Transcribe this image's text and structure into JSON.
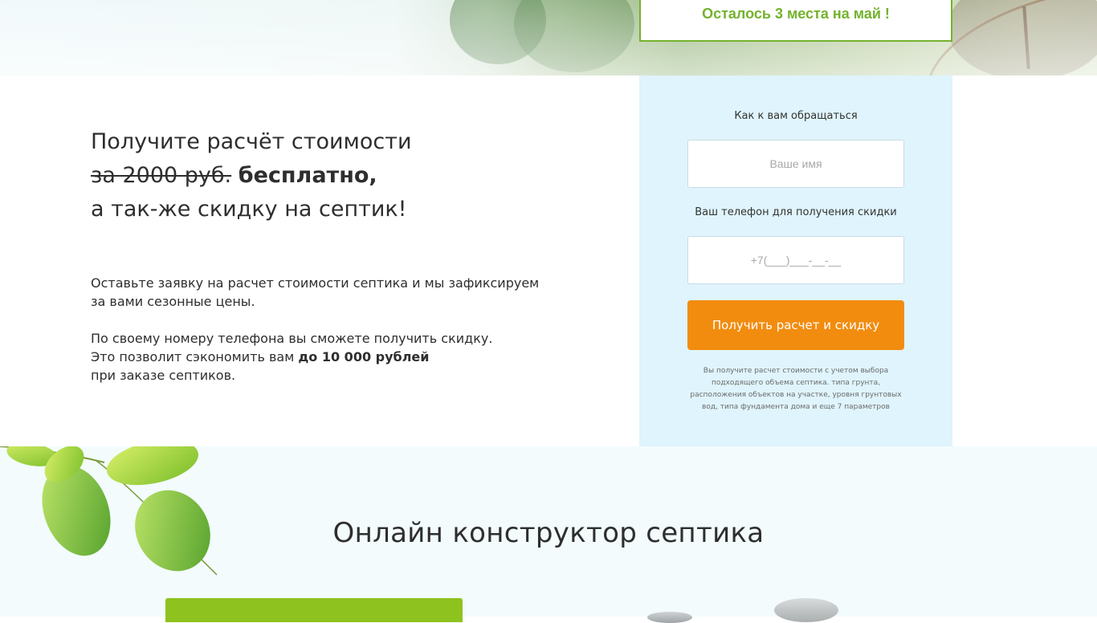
{
  "banner": {
    "promo_text": "Осталось 3 места на май !"
  },
  "offer": {
    "line1": "Получите расчёт стоимости",
    "old_price": "за 2000 руб.",
    "free": "бесплатно,",
    "line3": "а так-же скидку на септик!"
  },
  "description": {
    "p1": "Оставьте заявку на расчет стоимости септика и мы зафиксируем за вами сезонные цены.",
    "p2_line1": "По своему номеру телефона вы сможете получить скидку.",
    "p2_line2_prefix": "Это позволит сэкономить вам ",
    "p2_discount": "до 10 000 рублей",
    "p2_line3": "при заказе септиков."
  },
  "form": {
    "name_label": "Как к вам обращаться",
    "name_placeholder": "Ваше имя",
    "phone_label": "Ваш телефон для получения скидки",
    "phone_placeholder": "+7(___)___-__-__",
    "submit_label": "Получить расчет и скидку",
    "fine_print": "Вы получите расчет стоимости с учетом выбора подходящего объема септика. типа грунта, расположения объектов на участке, уровня грунтовых вод, типа фундамента дома и еще 7 параметров"
  },
  "constructor": {
    "title": "Онлайн конструктор септика"
  },
  "colors": {
    "accent_green": "#74b22d",
    "button_orange": "#f28c0f",
    "form_bg": "#dff4fc",
    "bright_green": "#8dc21f"
  }
}
